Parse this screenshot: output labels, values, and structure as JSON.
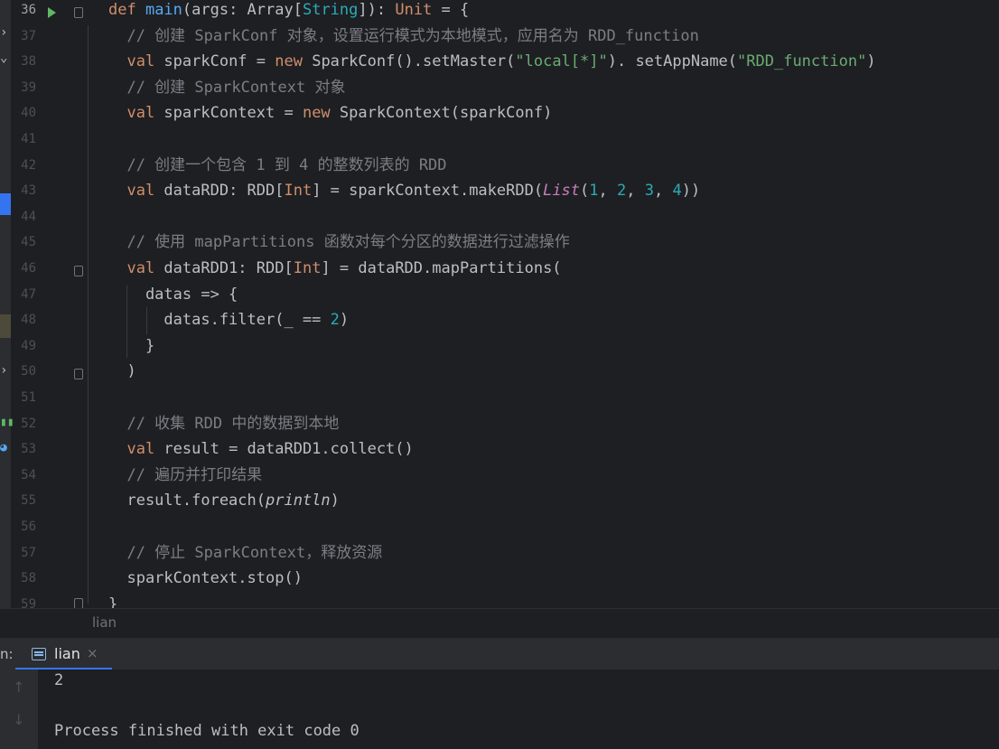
{
  "editor": {
    "lines": [
      {
        "n": "36",
        "segs": [
          [
            "kw",
            "def "
          ],
          [
            "fn",
            "main"
          ],
          [
            "",
            "(args: Array["
          ],
          [
            "ty",
            "String"
          ],
          [
            "",
            "]): "
          ],
          [
            "kw",
            "Unit"
          ],
          [
            "",
            " = {"
          ]
        ]
      },
      {
        "n": "37",
        "segs": [
          [
            "cm",
            "  // 创建 SparkConf 对象，设置运行模式为本地模式，应用名为 RDD_function"
          ]
        ]
      },
      {
        "n": "38",
        "segs": [
          [
            "kw",
            "  val "
          ],
          [
            "",
            "sparkConf = "
          ],
          [
            "kw",
            "new "
          ],
          [
            "",
            "SparkConf().setMaster("
          ],
          [
            "str",
            "\"local[*]\""
          ],
          [
            "",
            "). setAppName("
          ],
          [
            "str",
            "\"RDD_function\""
          ],
          [
            "",
            ")"
          ]
        ]
      },
      {
        "n": "39",
        "segs": [
          [
            "cm",
            "  // 创建 SparkContext 对象"
          ]
        ]
      },
      {
        "n": "40",
        "segs": [
          [
            "kw",
            "  val "
          ],
          [
            "",
            "sparkContext = "
          ],
          [
            "kw",
            "new "
          ],
          [
            "",
            "SparkContext(sparkConf)"
          ]
        ]
      },
      {
        "n": "41",
        "segs": []
      },
      {
        "n": "42",
        "segs": [
          [
            "cm",
            "  // 创建一个包含 1 到 4 的整数列表的 RDD"
          ]
        ]
      },
      {
        "n": "43",
        "segs": [
          [
            "kw",
            "  val "
          ],
          [
            "",
            "dataRDD: RDD["
          ],
          [
            "kw",
            "Int"
          ],
          [
            "",
            "] = sparkContext.makeRDD("
          ],
          [
            "it",
            "List"
          ],
          [
            "",
            "("
          ],
          [
            "num",
            "1"
          ],
          [
            "",
            ", "
          ],
          [
            "num",
            "2"
          ],
          [
            "",
            ", "
          ],
          [
            "num",
            "3"
          ],
          [
            "",
            ", "
          ],
          [
            "num",
            "4"
          ],
          [
            "",
            "))"
          ]
        ]
      },
      {
        "n": "44",
        "segs": []
      },
      {
        "n": "45",
        "segs": [
          [
            "cm",
            "  // 使用 mapPartitions 函数对每个分区的数据进行过滤操作"
          ]
        ]
      },
      {
        "n": "46",
        "segs": [
          [
            "kw",
            "  val "
          ],
          [
            "",
            "dataRDD1: RDD["
          ],
          [
            "kw",
            "Int"
          ],
          [
            "",
            "] = dataRDD.mapPartitions("
          ]
        ]
      },
      {
        "n": "47",
        "segs": [
          [
            "",
            "    datas => {"
          ]
        ]
      },
      {
        "n": "48",
        "segs": [
          [
            "",
            "      datas.filter(_ == "
          ],
          [
            "num",
            "2"
          ],
          [
            "",
            ")"
          ]
        ]
      },
      {
        "n": "49",
        "segs": [
          [
            "",
            "    }"
          ]
        ]
      },
      {
        "n": "50",
        "segs": [
          [
            "",
            "  )"
          ]
        ]
      },
      {
        "n": "51",
        "segs": []
      },
      {
        "n": "52",
        "segs": [
          [
            "cm",
            "  // 收集 RDD 中的数据到本地"
          ]
        ]
      },
      {
        "n": "53",
        "segs": [
          [
            "kw",
            "  val "
          ],
          [
            "",
            "result = dataRDD1.collect()"
          ]
        ]
      },
      {
        "n": "54",
        "segs": [
          [
            "cm",
            "  // 遍历并打印结果"
          ]
        ]
      },
      {
        "n": "55",
        "segs": [
          [
            "",
            "  result.foreach("
          ],
          [
            "it2",
            "println"
          ],
          [
            "",
            ")"
          ]
        ]
      },
      {
        "n": "56",
        "segs": []
      },
      {
        "n": "57",
        "segs": [
          [
            "cm",
            "  // 停止 SparkContext，释放资源"
          ]
        ]
      },
      {
        "n": "58",
        "segs": [
          [
            "",
            "  sparkContext.stop()"
          ]
        ]
      },
      {
        "n": "59",
        "segs": [
          [
            "",
            "}"
          ]
        ]
      }
    ]
  },
  "breadcrumb": "lian",
  "run_panel": {
    "prefix": "n:",
    "tab_label": "lian",
    "tab_close": "×",
    "tab_icon": "console-icon",
    "output": [
      "2",
      "",
      "Process finished with exit code 0"
    ],
    "up_arrow": "↑",
    "down_arrow": "↓"
  },
  "colors": {
    "keyword": "#cf8e6d",
    "function": "#56a8f5",
    "string": "#6aab73",
    "number": "#2aacb8",
    "comment": "#7a7e85",
    "accent": "#3574f0"
  }
}
